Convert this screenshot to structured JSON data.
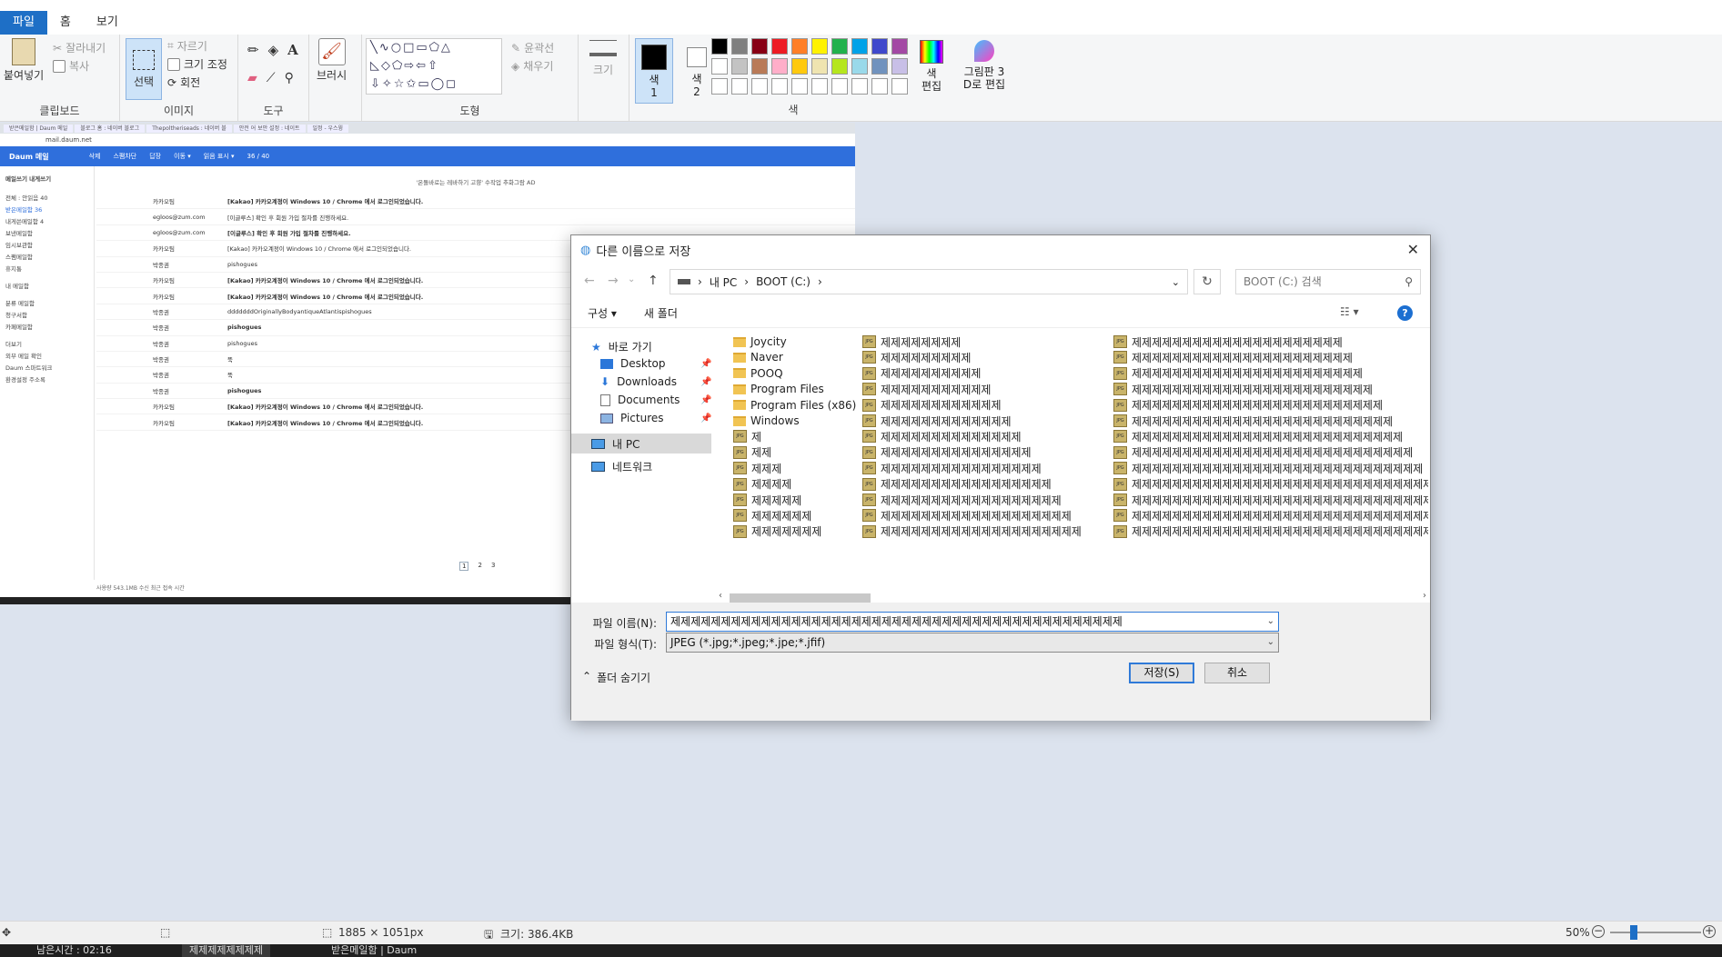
{
  "app": {
    "menu_tabs": [
      "파일",
      "홈",
      "보기"
    ]
  },
  "ribbon": {
    "clipboard": {
      "paste": "붙여넣기",
      "cut": "잘라내기",
      "copy": "복사",
      "label": "클립보드"
    },
    "image": {
      "select": "선택",
      "crop": "자르기",
      "resize": "크기 조정",
      "rotate": "회전",
      "label": "이미지"
    },
    "tools": {
      "label": "도구"
    },
    "brush": {
      "label": "브러시"
    },
    "shapes": {
      "outline": "윤곽선",
      "fill": "채우기",
      "label": "도형"
    },
    "size": {
      "label": "크기"
    },
    "colors": {
      "color1": "색\n1",
      "color2": "색\n2",
      "edit": "색\n편집",
      "paint3d": "그림판 3\nD로 편집",
      "label": "색",
      "palette": [
        "#000000",
        "#7f7f7f",
        "#880015",
        "#ed1c24",
        "#ff7f27",
        "#fff200",
        "#22b14c",
        "#00a2e8",
        "#3f48cc",
        "#a349a4",
        "#ffffff",
        "#c3c3c3",
        "#b97a57",
        "#ffaec9",
        "#ffc90e",
        "#efe4b0",
        "#b5e61d",
        "#99d9ea",
        "#7092be",
        "#c8bfe7"
      ]
    }
  },
  "browser": {
    "tabs": [
      "받은메일함 | Daum 메일",
      "블로그 홈 : 네이버 블로그",
      "Thepoltheriseads : 네이버 블",
      "안전 어 보안 설정 : 네이트",
      "일정 - 우스윙"
    ],
    "url": "mail.daum.net",
    "mail_logo": "Daum 메일",
    "toolbar": [
      "삭제",
      "스팸차단",
      "답장",
      "이동 ▾",
      "읽음 표시 ▾",
      "36 / 40"
    ],
    "sidebar": [
      "메일쓰기   내게쓰기",
      "전체 : 안읽음 40",
      "받은메일함 36",
      "내게쓴메일함 4",
      "보낸메일함",
      "임시보관함",
      "스팸메일함",
      "휴지통",
      "내 메일함",
      "분류 메일함",
      "청구서함",
      "카페메일함",
      "더보기",
      "외부 메일 확인",
      "Daum 스마트워크",
      "환경설정   주소록"
    ],
    "notice": "'온돌바로는 레바하기 고향' 수작업 추화그람 AD",
    "rows": [
      {
        "sender": "카카오팀",
        "subject": "[Kakao] 카카오계정이 Windows 10 / Chrome 에서 로그인되었습니다.",
        "bold": true
      },
      {
        "sender": "egloos@zum.com",
        "subject": "[이글루스] 확인 후 회원 가입 절차를 진행하세요.",
        "bold": false
      },
      {
        "sender": "egloos@zum.com",
        "subject": "[이글루스] 확인 후 회원 가입 절차를 진행하세요.",
        "bold": true
      },
      {
        "sender": "카카오팀",
        "subject": "[Kakao] 카카오계정이 Windows 10 / Chrome 에서 로그인되었습니다.",
        "bold": false
      },
      {
        "sender": "박종권",
        "subject": "pishogues",
        "bold": false
      },
      {
        "sender": "카카오팀",
        "subject": "[Kakao] 카카오계정이 Windows 10 / Chrome 에서 로그인되었습니다.",
        "bold": true
      },
      {
        "sender": "카카오팀",
        "subject": "[Kakao] 카카오계정이 Windows 10 / Chrome 에서 로그인되었습니다.",
        "bold": true
      },
      {
        "sender": "박종권",
        "subject": "dddddddOriginallyBodyantiqueAtlantispishogues",
        "bold": false
      },
      {
        "sender": "박종권",
        "subject": "pishogues",
        "bold": true
      },
      {
        "sender": "박종권",
        "subject": "pishogues",
        "bold": false
      },
      {
        "sender": "박종권",
        "subject": "뚝",
        "bold": false
      },
      {
        "sender": "박종권",
        "subject": "뚝",
        "bold": false
      },
      {
        "sender": "박종권",
        "subject": "pishogues",
        "bold": true
      },
      {
        "sender": "카카오팀",
        "subject": "[Kakao] 카카오계정이 Windows 10 / Chrome 에서 로그인되었습니다.",
        "bold": true
      },
      {
        "sender": "카카오팀",
        "subject": "[Kakao] 카카오계정이 Windows 10 / Chrome 에서 로그인되었습니다.",
        "bold": true
      }
    ],
    "pages": [
      "1",
      "2",
      "3"
    ],
    "footer": "사용량 543.1MB   수신   최근 접속 시간"
  },
  "dialog": {
    "title": "다른 이름으로 저장",
    "breadcrumb": [
      "내 PC",
      "BOOT (C:)"
    ],
    "search_placeholder": "BOOT (C:) 검색",
    "organize": "구성 ▾",
    "new_folder": "새 폴더",
    "nav": {
      "quick": "바로 가기",
      "desktop": "Desktop",
      "downloads": "Downloads",
      "documents": "Documents",
      "pictures": "Pictures",
      "thispc": "내 PC",
      "network": "네트워크"
    },
    "col1": [
      {
        "name": "Joycity",
        "type": "folder"
      },
      {
        "name": "Naver",
        "type": "folder"
      },
      {
        "name": "POOQ",
        "type": "folder"
      },
      {
        "name": "Program Files",
        "type": "folder"
      },
      {
        "name": "Program Files (x86)",
        "type": "folder"
      },
      {
        "name": "Windows",
        "type": "folder"
      },
      {
        "name": "제",
        "type": "jpg"
      },
      {
        "name": "제제",
        "type": "jpg"
      },
      {
        "name": "제제제",
        "type": "jpg"
      },
      {
        "name": "제제제제",
        "type": "jpg"
      },
      {
        "name": "제제제제제",
        "type": "jpg"
      },
      {
        "name": "제제제제제제",
        "type": "jpg"
      },
      {
        "name": "제제제제제제제",
        "type": "jpg"
      }
    ],
    "col2": [
      "제제제제제제제제",
      "제제제제제제제제제",
      "제제제제제제제제제제",
      "제제제제제제제제제제제",
      "제제제제제제제제제제제제",
      "제제제제제제제제제제제제제",
      "제제제제제제제제제제제제제제",
      "제제제제제제제제제제제제제제제",
      "제제제제제제제제제제제제제제제제",
      "제제제제제제제제제제제제제제제제제",
      "제제제제제제제제제제제제제제제제제제",
      "제제제제제제제제제제제제제제제제제제제",
      "제제제제제제제제제제제제제제제제제제제제"
    ],
    "col3": [
      "제제제제제제제제제제제제제제제제제제제제제",
      "제제제제제제제제제제제제제제제제제제제제제제",
      "제제제제제제제제제제제제제제제제제제제제제제제",
      "제제제제제제제제제제제제제제제제제제제제제제제제",
      "제제제제제제제제제제제제제제제제제제제제제제제제제",
      "제제제제제제제제제제제제제제제제제제제제제제제제제제",
      "제제제제제제제제제제제제제제제제제제제제제제제제제제제",
      "제제제제제제제제제제제제제제제제제제제제제제제제제제제제",
      "제제제제제제제제제제제제제제제제제제제제제제제제제제제제제",
      "제제제제제제제제제제제제제제제제제제제제제제제제제제제제제제",
      "제제제제제제제제제제제제제제제제제제제제제제제제제제제제제제제",
      "제제제제제제제제제제제제제제제제제제제제제제제제제제제제제제제제",
      "제제제제제제제제제제제제제제제제제제제제제제제제제제제제제제제제제"
    ],
    "filename_label": "파일 이름(N):",
    "filename_value": "제제제제제제제제제제제제제제제제제제제제제제제제제제제제제제제제제제제제제제제제제제제제제",
    "filetype_label": "파일 형식(T):",
    "filetype_value": "JPEG (*.jpg;*.jpeg;*.jpe;*.jfif)",
    "hide_folders": "폴더 숨기기",
    "save": "저장(S)",
    "cancel": "취소"
  },
  "status": {
    "dimensions": "1885 × 1051px",
    "size": "크기: 386.4KB",
    "zoom": "50%"
  },
  "taskbar": {
    "items": [
      "남은시간 : 02:16",
      "제제제제제제제제",
      "받은메일함 | Daum"
    ]
  }
}
